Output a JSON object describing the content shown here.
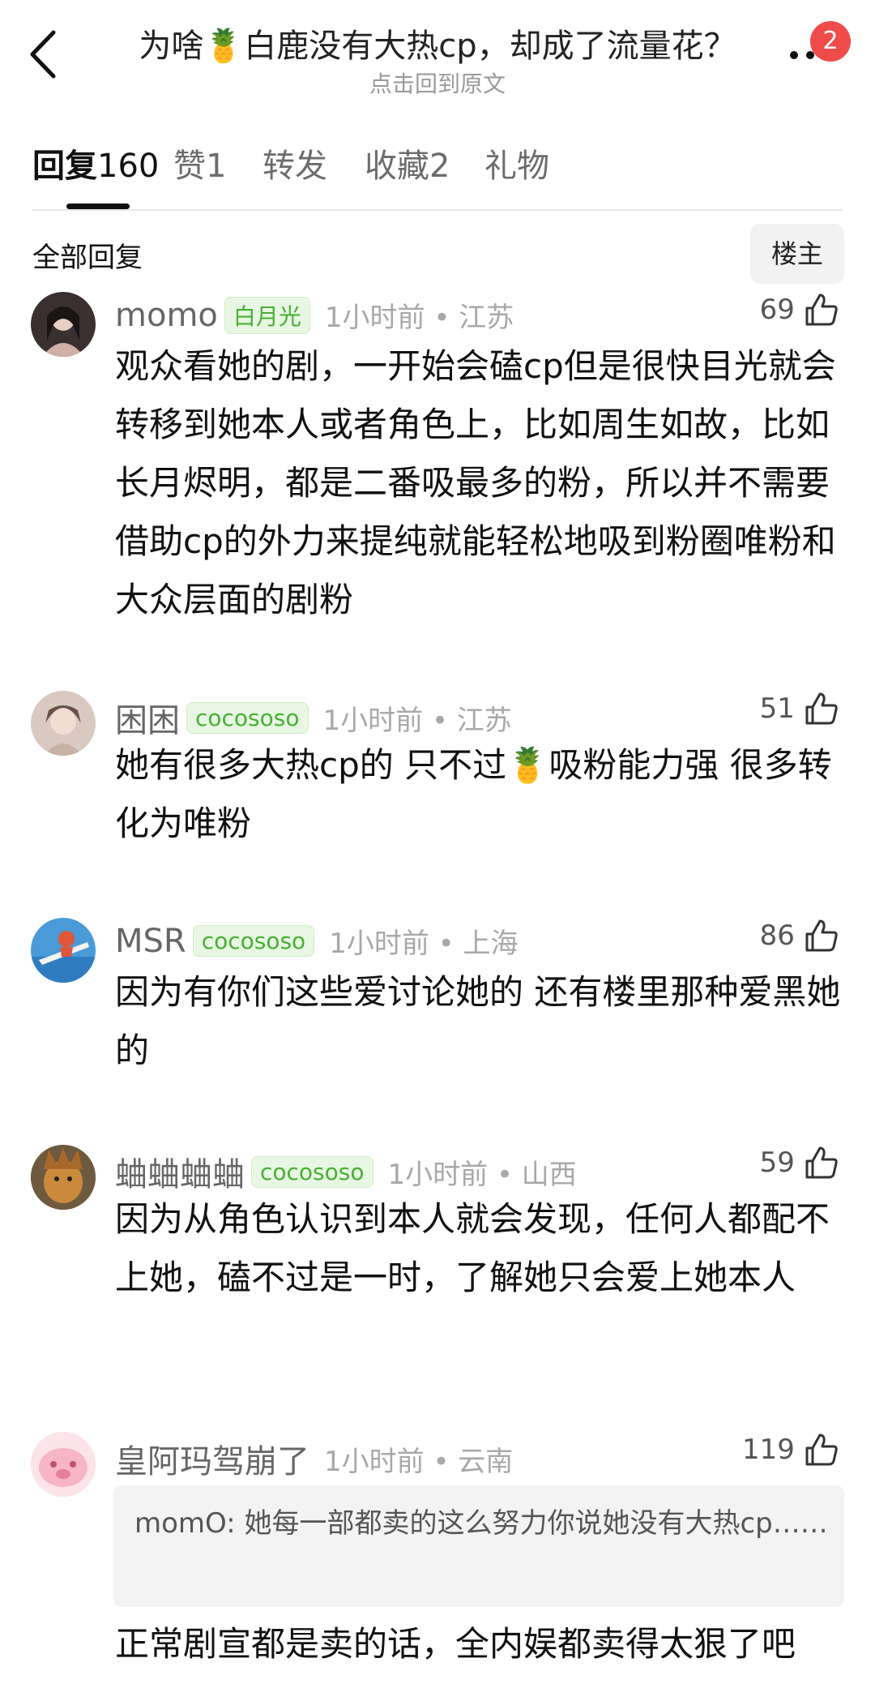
{
  "header": {
    "title": "为啥🍍白鹿没有大热cp，却成了流量花？",
    "subtitle": "点击回到原文",
    "badge_count": "2"
  },
  "tabs": [
    {
      "label": "回复",
      "count": "160"
    },
    {
      "label": "赞",
      "count": "1"
    },
    {
      "label": "转发",
      "count": ""
    },
    {
      "label": "收藏",
      "count": "2"
    },
    {
      "label": "礼物",
      "count": ""
    }
  ],
  "section": {
    "title": "全部回复",
    "owner_button": "楼主"
  },
  "comments": [
    {
      "name": "momo",
      "tag": "白月光",
      "time": "1小时前 • 江苏",
      "likes": "69",
      "text": "观众看她的剧，一开始会磕cp但是很快目光就会转移到她本人或者角色上，比如周生如故，比如长月烬明，都是二番吸最多的粉，所以并不需要借助cp的外力来提纯就能轻松地吸到粉圈唯粉和大众层面的剧粉",
      "avatar_color": "#3a3030"
    },
    {
      "name": "困困",
      "tag": "cocososo",
      "time": "1小时前 • 江苏",
      "likes": "51",
      "text": "她有很多大热cp的 只不过🍍吸粉能力强 很多转化为唯粉",
      "avatar_color": "#d9c9c0"
    },
    {
      "name": "MSR",
      "tag": "cocososo",
      "time": "1小时前 • 上海",
      "likes": "86",
      "text": "因为有你们这些爱讨论她的 还有楼里那种爱黑她的",
      "avatar_color": "#4a9ad8"
    },
    {
      "name": "蛐蛐蛐蛐",
      "tag": "cocososo",
      "time": "1小时前 • 山西",
      "likes": "59",
      "text": "因为从角色认识到本人就会发现，任何人都配不上她，磕不过是一时，了解她只会爱上她本人",
      "avatar_color": "#8a6a3a"
    },
    {
      "name": "皇阿玛驾崩了",
      "tag": "",
      "time": "1小时前 • 云南",
      "likes": "119",
      "quote": "momO: 她每一部都卖的这么努力你说她没有大热cp……",
      "text": "正常剧宣都是卖的话，全内娱都卖得太狠了吧",
      "avatar_color": "#f7c9d4"
    }
  ]
}
